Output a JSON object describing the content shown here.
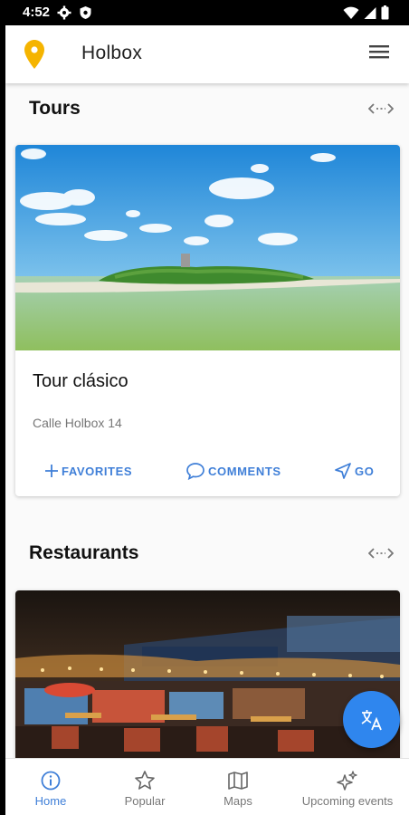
{
  "status_bar": {
    "time": "4:52"
  },
  "app": {
    "title": "Holbox"
  },
  "sections": [
    {
      "heading": "Tours",
      "card": {
        "name": "Tour clásico",
        "address": "Calle Holbox 14",
        "actions": {
          "favorites": "FAVORITES",
          "comments": "COMMENTS",
          "go": "GO"
        }
      }
    },
    {
      "heading": "Restaurants"
    }
  ],
  "bottom_nav": [
    {
      "label": "Home",
      "icon": "info-icon",
      "active": true
    },
    {
      "label": "Popular",
      "icon": "star-icon",
      "active": false
    },
    {
      "label": "Maps",
      "icon": "map-icon",
      "active": false
    },
    {
      "label": "Upcoming events",
      "icon": "sparkles-icon",
      "active": false
    }
  ],
  "colors": {
    "accent": "#3f7fd8",
    "fab": "#2f86ee",
    "pin": "#f5b400"
  }
}
